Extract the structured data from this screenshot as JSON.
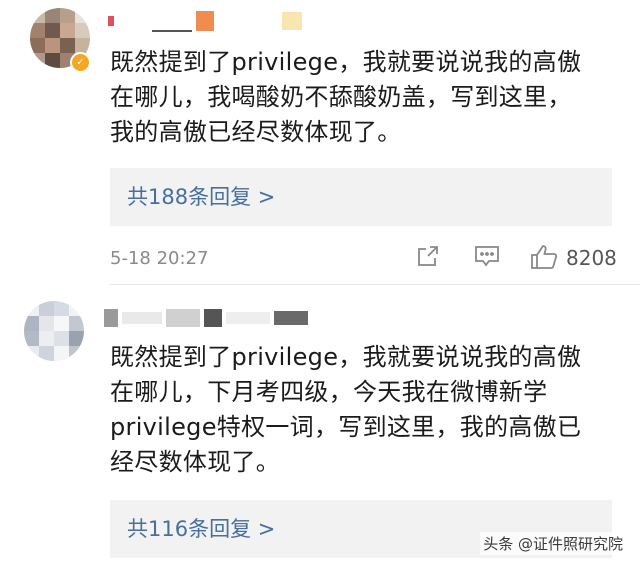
{
  "comments": [
    {
      "text_lines": [
        "既然提到了privilege，我就要说说我的高傲",
        "在哪儿，我喝酸奶不舔酸奶盖，写到这里，",
        "我的高傲已经尽数体现了。"
      ],
      "replies_label": "共188条回复 >",
      "time": "5-18 20:27",
      "like_count": "8208"
    },
    {
      "text_lines": [
        "既然提到了privilege，我就要说说我的高傲",
        "在哪儿，下月考四级，今天我在微博新学",
        "privilege特权一词，写到这里，我的高傲已",
        "经尽数体现了。"
      ],
      "replies_label": "共116条回复 >"
    }
  ],
  "icons": {
    "share": "share-icon",
    "comment": "comment-icon",
    "like": "thumbs-up-icon",
    "verified": "verified-badge-icon"
  },
  "watermark": "头条 @证件照研究院",
  "colors": {
    "link": "#476e9e",
    "reply_bg": "#f2f2f2",
    "meta": "#8a8a8a",
    "badge": "#f5a623"
  }
}
